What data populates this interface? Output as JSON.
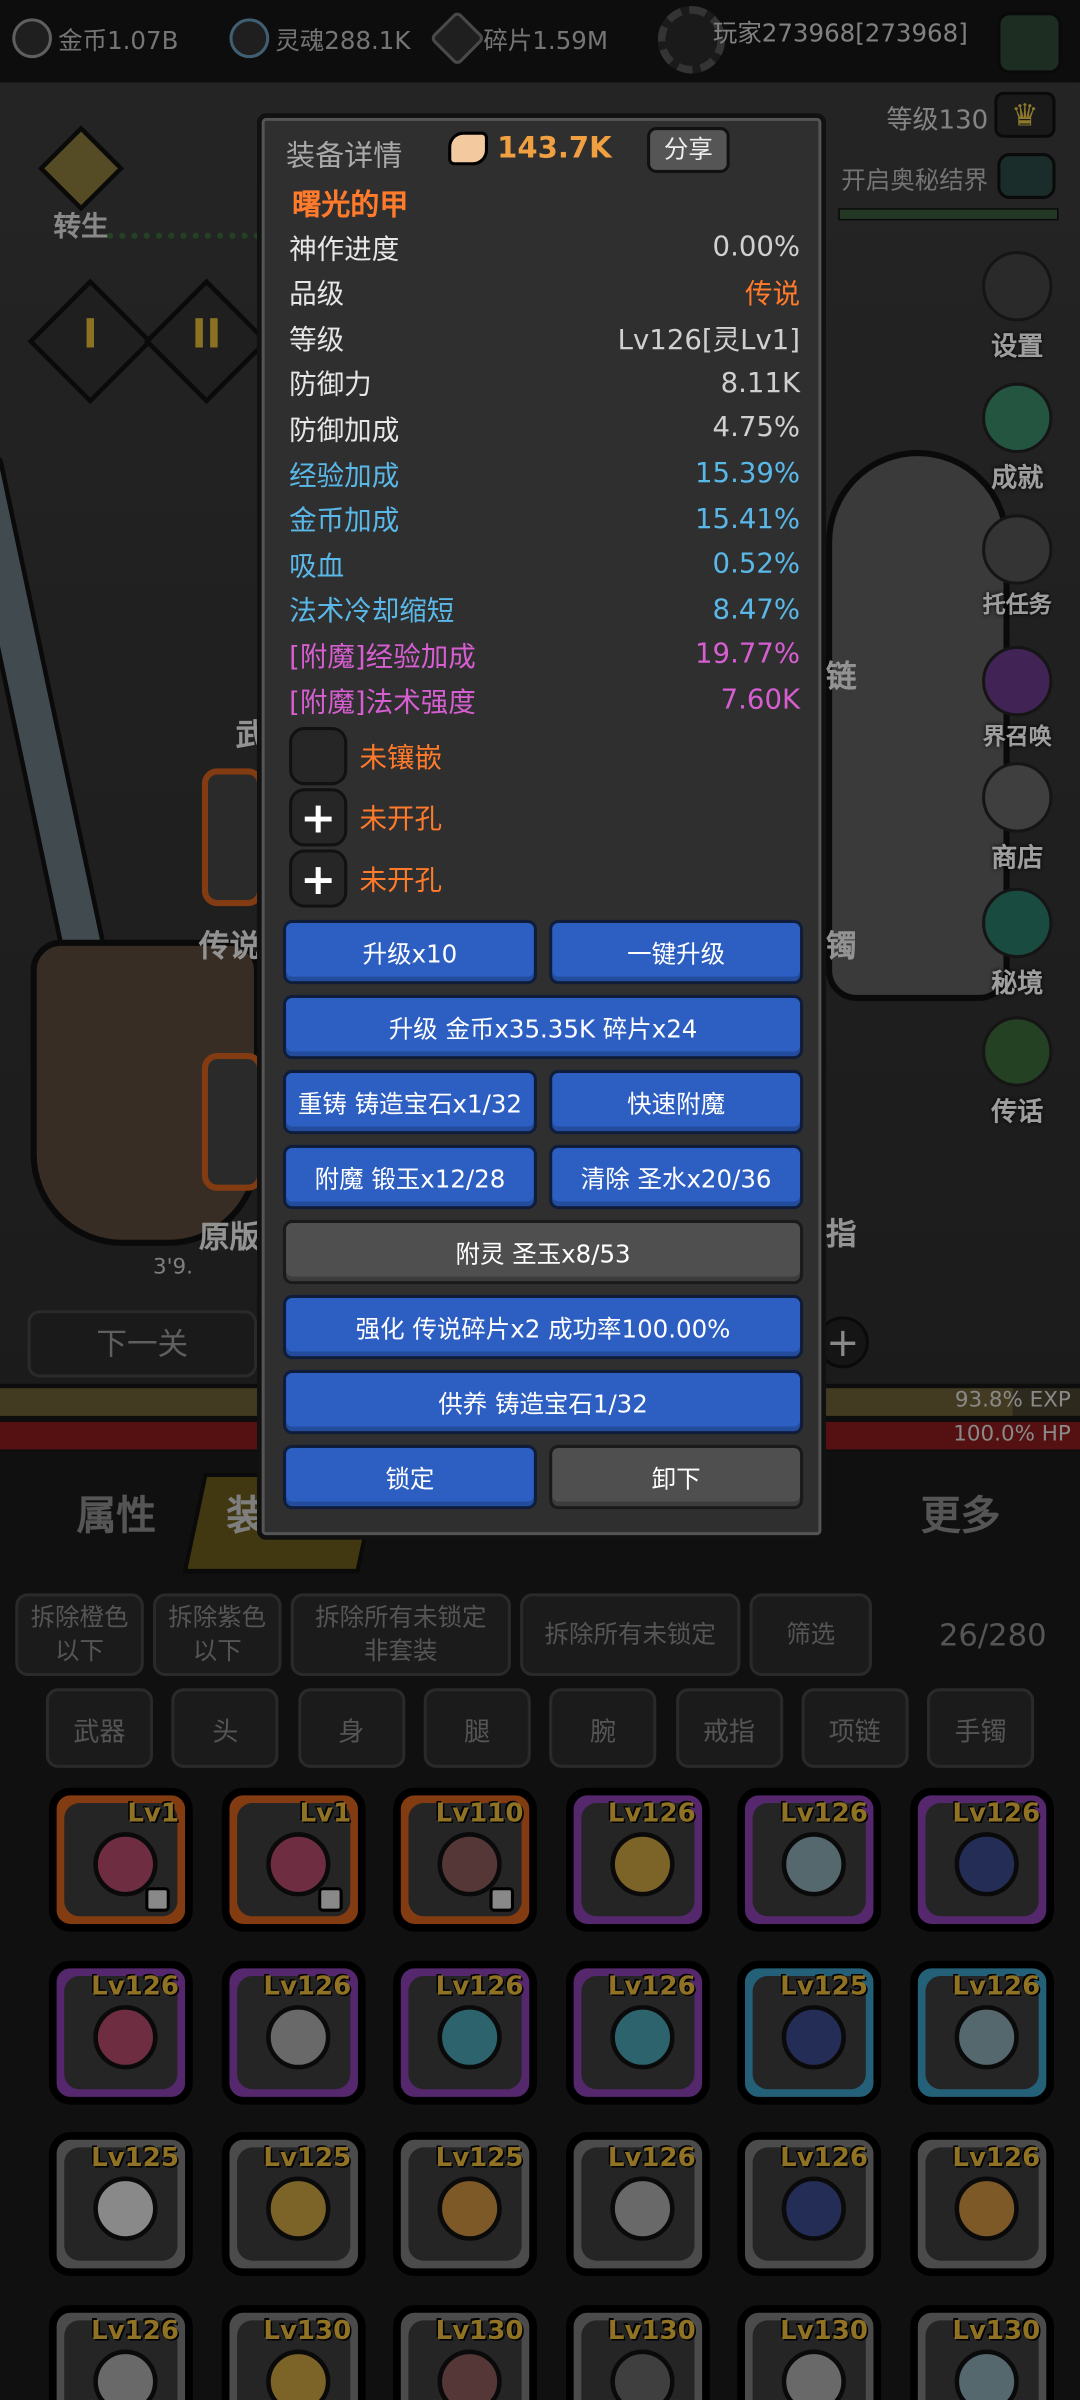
{
  "top_bar": {
    "resources": [
      {
        "icon": "coin-icon",
        "text": "金币1.07B"
      },
      {
        "icon": "soul-icon",
        "text": "灵魂288.1K"
      },
      {
        "icon": "shard-icon",
        "text": "碎片1.59M"
      }
    ],
    "player": "玩家273968[273968]",
    "level": "等级130",
    "mystic_barrier": "开启奥秘结界"
  },
  "scene": {
    "rebirth": "转生",
    "roman_tabs": [
      "I",
      "II"
    ],
    "equip_labels_left": [
      "武",
      "传说",
      "原版"
    ],
    "equip_labels_right": [
      "链",
      "镯",
      "指"
    ],
    "bot_num": "3'9.",
    "next_level": "下一关",
    "exp": "93.8% EXP",
    "hp": "100.0% HP",
    "side_menu": [
      "设置",
      "成就",
      "托任务",
      "界召唤",
      "商店",
      "秘境",
      "传话"
    ]
  },
  "modal": {
    "header": "装备详情",
    "power": "143.7K",
    "share": "分享",
    "item_name": "曙光的甲",
    "stats": [
      {
        "label": "神作进度",
        "value": "0.00%",
        "color": "#e6e6e6"
      },
      {
        "label": "品级",
        "value": "传说",
        "color": "#e6e6e6",
        "value_color": "#ff7a2a"
      },
      {
        "label": "等级",
        "value": "Lv126[灵Lv1]",
        "color": "#e6e6e6"
      },
      {
        "label": "防御力",
        "value": "8.11K",
        "color": "#e6e6e6"
      },
      {
        "label": "防御加成",
        "value": "4.75%",
        "color": "#e6e6e6"
      },
      {
        "label": "经验加成",
        "value": "15.39%",
        "color": "#5ab8e8"
      },
      {
        "label": "金币加成",
        "value": "15.41%",
        "color": "#5ab8e8"
      },
      {
        "label": "吸血",
        "value": "0.52%",
        "color": "#5ab8e8"
      },
      {
        "label": "法术冷却缩短",
        "value": "8.47%",
        "color": "#5ab8e8"
      },
      {
        "label": "[附魔]经验加成",
        "value": "19.77%",
        "color": "#d65ed1"
      },
      {
        "label": "[附魔]法术强度",
        "value": "7.60K",
        "color": "#d65ed1"
      }
    ],
    "sockets": [
      "未镶嵌",
      "未开孔",
      "未开孔"
    ],
    "buttons": {
      "upgrade10": "升级x10",
      "one_key_upgrade": "一键升级",
      "upgrade_cost": "升级 金币x35.35K 碎片x24",
      "reforge": "重铸 铸造宝石x1/32",
      "quick_enchant": "快速附魔",
      "enchant": "附魔 锻玉x12/28",
      "clear": "清除 圣水x20/36",
      "spirit": "附灵 圣玉x8/53",
      "strengthen": "强化 传说碎片x2 成功率100.00%",
      "offer": "供养 铸造宝石1/32",
      "lock": "锁定",
      "unequip": "卸下"
    }
  },
  "bottom": {
    "tabs": [
      "属性",
      "装",
      "更多"
    ],
    "tab_partial": "装",
    "filters": [
      "拆除橙色\n以下",
      "拆除紫色\n以下",
      "拆除所有未锁定\n非套装",
      "拆除所有未锁定",
      "筛选"
    ],
    "count": "26/280",
    "categories": [
      "武器",
      "头",
      "身",
      "腿",
      "腕",
      "戒指",
      "项链",
      "手镯"
    ],
    "items": [
      {
        "lv": "Lv1",
        "rarity": "orange",
        "icon": "necklace-icon",
        "locked": true
      },
      {
        "lv": "Lv1",
        "rarity": "orange",
        "icon": "necklace-icon",
        "locked": true
      },
      {
        "lv": "Lv110",
        "rarity": "orange",
        "icon": "hammer-icon",
        "locked": true
      },
      {
        "lv": "Lv126",
        "rarity": "purple",
        "icon": "ring-icon",
        "locked": false
      },
      {
        "lv": "Lv126",
        "rarity": "purple",
        "icon": "armor-icon",
        "locked": false
      },
      {
        "lv": "Lv126",
        "rarity": "purple",
        "icon": "boot-icon",
        "locked": false
      },
      {
        "lv": "Lv126",
        "rarity": "purple",
        "icon": "necklace-icon",
        "locked": false
      },
      {
        "lv": "Lv126",
        "rarity": "purple",
        "icon": "sword-icon",
        "locked": false
      },
      {
        "lv": "Lv126",
        "rarity": "purple",
        "icon": "bracelet-icon",
        "locked": false
      },
      {
        "lv": "Lv126",
        "rarity": "purple",
        "icon": "bracelet-icon",
        "locked": false
      },
      {
        "lv": "Lv125",
        "rarity": "blue",
        "icon": "boot-icon",
        "locked": false
      },
      {
        "lv": "Lv126",
        "rarity": "blue",
        "icon": "armor-icon",
        "locked": false
      },
      {
        "lv": "Lv125",
        "rarity": "gray",
        "icon": "hat-icon",
        "locked": false
      },
      {
        "lv": "Lv125",
        "rarity": "gray",
        "icon": "ring-icon",
        "locked": false
      },
      {
        "lv": "Lv125",
        "rarity": "gray",
        "icon": "helmet-icon",
        "locked": false
      },
      {
        "lv": "Lv126",
        "rarity": "gray",
        "icon": "sword-icon",
        "locked": false
      },
      {
        "lv": "Lv126",
        "rarity": "gray",
        "icon": "boot-icon",
        "locked": false
      },
      {
        "lv": "Lv126",
        "rarity": "gray",
        "icon": "helmet-icon",
        "locked": false
      },
      {
        "lv": "Lv126",
        "rarity": "gray",
        "icon": "sword-icon",
        "locked": false
      },
      {
        "lv": "Lv130",
        "rarity": "gray",
        "icon": "ring-icon",
        "locked": false
      },
      {
        "lv": "Lv130",
        "rarity": "gray",
        "icon": "hammer-icon",
        "locked": false
      },
      {
        "lv": "Lv130",
        "rarity": "gray",
        "icon": "staff-icon",
        "locked": false
      },
      {
        "lv": "Lv130",
        "rarity": "gray",
        "icon": "sword-icon",
        "locked": false
      },
      {
        "lv": "Lv130",
        "rarity": "gray",
        "icon": "armor-icon",
        "locked": false
      }
    ],
    "rarity_colors": {
      "orange": "#d4621e",
      "purple": "#8a3fb0",
      "blue": "#3d9bc4",
      "gray": "#7a7a7a"
    }
  }
}
